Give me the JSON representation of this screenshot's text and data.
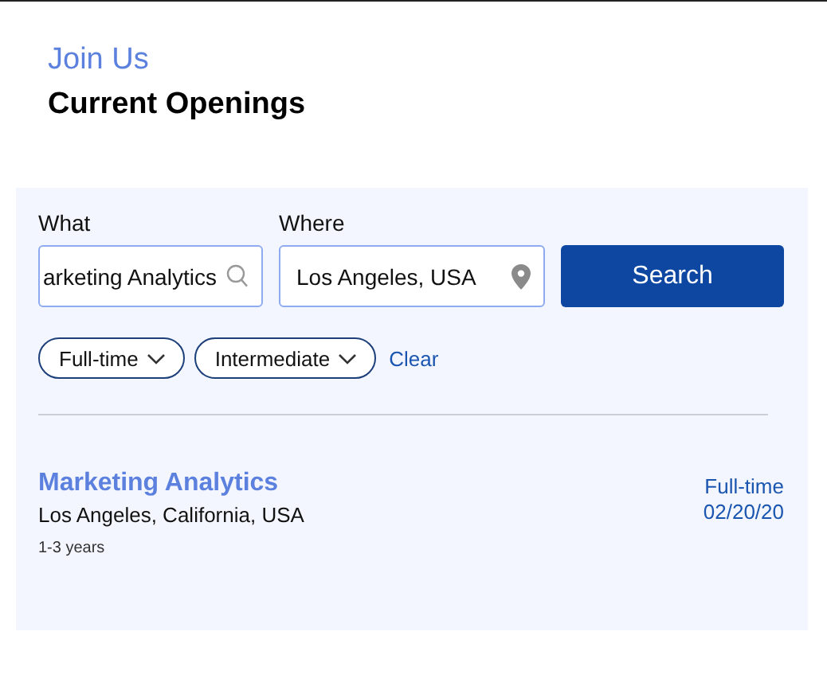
{
  "header": {
    "eyebrow": "Join Us",
    "title": "Current Openings"
  },
  "search": {
    "what_label": "What",
    "what_value": "arketing Analytics",
    "where_label": "Where",
    "where_value": "Los Angeles, USA",
    "button": "Search"
  },
  "filters": [
    {
      "label": "Full-time"
    },
    {
      "label": "Intermediate"
    }
  ],
  "clear": "Clear",
  "jobs": [
    {
      "title": "Marketing Analytics",
      "location": "Los Angeles, California, USA",
      "experience": "1-3 years",
      "type": "Full-time",
      "date": "02/20/20"
    }
  ]
}
